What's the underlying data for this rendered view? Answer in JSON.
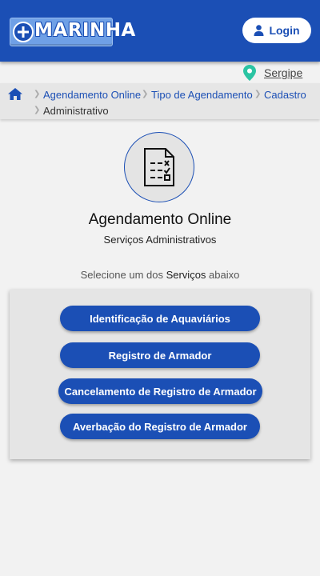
{
  "header": {
    "logo_text": "MARINHA",
    "login_label": "Login"
  },
  "location": {
    "label": "Sergipe",
    "pin_color": "#2bc4a3"
  },
  "breadcrumb": {
    "items": [
      "Agendamento Online",
      "Tipo de Agendamento",
      "Cadastro",
      "Administrativo"
    ]
  },
  "page": {
    "title": "Agendamento Online",
    "subtitle": "Serviços Administrativos",
    "instruction_prefix": "Selecione um dos ",
    "instruction_emphasis": "Serviços",
    "instruction_suffix": " abaixo"
  },
  "services": [
    "Identificação de Aquaviários",
    "Registro de Armador",
    "Cancelamento de Registro de Armador",
    "Averbação do Registro de Armador"
  ],
  "colors": {
    "primary": "#1b4fb5",
    "background": "#f2f2f2",
    "panel": "#e5e5e5"
  }
}
